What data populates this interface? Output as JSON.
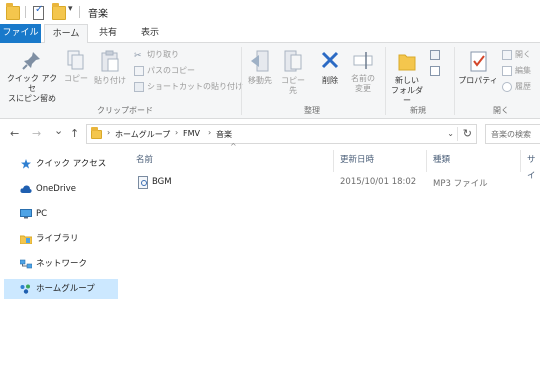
{
  "titlebar": {
    "title": "音楽",
    "qat_icons": [
      "folder-icon",
      "properties-check-icon",
      "new-folder-icon",
      "customize-dropdown-icon"
    ],
    "dropdown_glyph": "▾"
  },
  "ribbon_tabs": [
    {
      "label": "ファイル",
      "active": false,
      "accent": "#1979ca"
    },
    {
      "label": "ホーム",
      "active": true
    },
    {
      "label": "共有",
      "active": false
    },
    {
      "label": "表示",
      "active": false
    }
  ],
  "ribbon": {
    "clipboard": {
      "pin_label_1": "クイック アクセ",
      "pin_label_2": "スにピン留め",
      "copy_label": "コピー",
      "paste_label": "貼り付け",
      "cut_label": "切り取り",
      "copy_path_label": "パスのコピー",
      "paste_shortcut_label": "ショートカットの貼り付け",
      "group_label": "クリップボード"
    },
    "organize": {
      "move_label": "移動先",
      "copyto_label": "コピー先",
      "delete_label": "削除",
      "rename_label_1": "名前の",
      "rename_label_2": "変更",
      "group_label": "整理"
    },
    "new": {
      "newfolder_label_1": "新しい",
      "newfolder_label_2": "フォルダー",
      "group_label": "新規"
    },
    "open": {
      "properties_label": "プロパティ",
      "open_label": "開く",
      "edit_label": "編集",
      "history_label": "履歴",
      "group_label": "開く"
    }
  },
  "nav": {
    "back_glyph": "←",
    "forward_glyph": "→",
    "recent_glyph": "⌄",
    "up_glyph": "↑"
  },
  "address": {
    "crumbs": [
      "ホームグループ",
      "FMV",
      "音楽"
    ],
    "separator": "›",
    "dropdown_glyph": "⌄",
    "refresh_glyph": "↻",
    "search_placeholder": "音楽の検索"
  },
  "navpane": {
    "items": [
      {
        "label": "クイック アクセス",
        "icon": "star-icon",
        "selected": false
      },
      {
        "label": "OneDrive",
        "icon": "cloud-icon",
        "selected": false
      },
      {
        "label": "PC",
        "icon": "monitor-icon",
        "selected": false
      },
      {
        "label": "ライブラリ",
        "icon": "library-icon",
        "selected": false
      },
      {
        "label": "ネットワーク",
        "icon": "network-icon",
        "selected": false
      },
      {
        "label": "ホームグループ",
        "icon": "homegroup-icon",
        "selected": true
      }
    ]
  },
  "filelist": {
    "sort_glyph": "^",
    "columns": [
      "名前",
      "更新日時",
      "種類",
      "サイ"
    ],
    "rows": [
      {
        "name": "BGM",
        "modified": "2015/10/01 18:02",
        "type": "MP3 ファイル"
      }
    ]
  },
  "colors": {
    "file_tab": "#1979ca",
    "selected_nav": "#cce8ff",
    "folder": "#f4c64d",
    "column_header_text": "#4c607a"
  }
}
